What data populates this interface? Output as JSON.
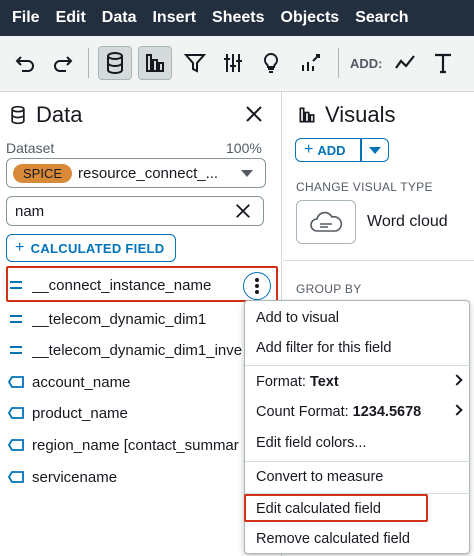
{
  "menubar": {
    "items": [
      "File",
      "Edit",
      "Data",
      "Insert",
      "Sheets",
      "Objects",
      "Search"
    ]
  },
  "toolbar": {
    "add_label": "ADD:",
    "icons": [
      "undo-icon",
      "redo-icon",
      "database-icon",
      "visuals-icon",
      "filter-icon",
      "properties-icon",
      "insights-icon",
      "stories-icon",
      "line-chart-icon",
      "text-icon"
    ]
  },
  "data_panel": {
    "title": "Data",
    "dataset_label": "Dataset",
    "dataset_percent": "100%",
    "spice_badge": "SPICE",
    "dataset_name": "resource_connect_...",
    "search_value": "nam",
    "calc_button_label": "CALCULATED FIELD",
    "fields": [
      {
        "name": "__connect_instance_name",
        "type": "dimension-calculated"
      },
      {
        "name": "__telecom_dynamic_dim1",
        "type": "dimension-calculated"
      },
      {
        "name": "__telecom_dynamic_dim1_inve",
        "type": "dimension-calculated"
      },
      {
        "name": "account_name",
        "type": "dimension"
      },
      {
        "name": "product_name",
        "type": "dimension"
      },
      {
        "name": "region_name [contact_summar",
        "type": "dimension"
      },
      {
        "name": "servicename",
        "type": "dimension"
      }
    ]
  },
  "visuals_panel": {
    "title": "Visuals",
    "add_label": "ADD",
    "change_type_label": "CHANGE VISUAL TYPE",
    "visual_type": "Word cloud",
    "group_by_label": "GROUP BY"
  },
  "context_menu": {
    "add_to_visual": "Add to visual",
    "add_filter": "Add filter for this field",
    "format_label": "Format:",
    "format_value": "Text",
    "count_format_label": "Count Format:",
    "count_format_value": "1234.5678",
    "edit_colors": "Edit field colors...",
    "convert_measure": "Convert to measure",
    "edit_calculated": "Edit calculated field",
    "remove_calculated": "Remove calculated field"
  },
  "colors": {
    "menubar": "#232f3e",
    "accent": "#0073bb",
    "highlight": "#d13212",
    "spice": "#d98a38"
  }
}
